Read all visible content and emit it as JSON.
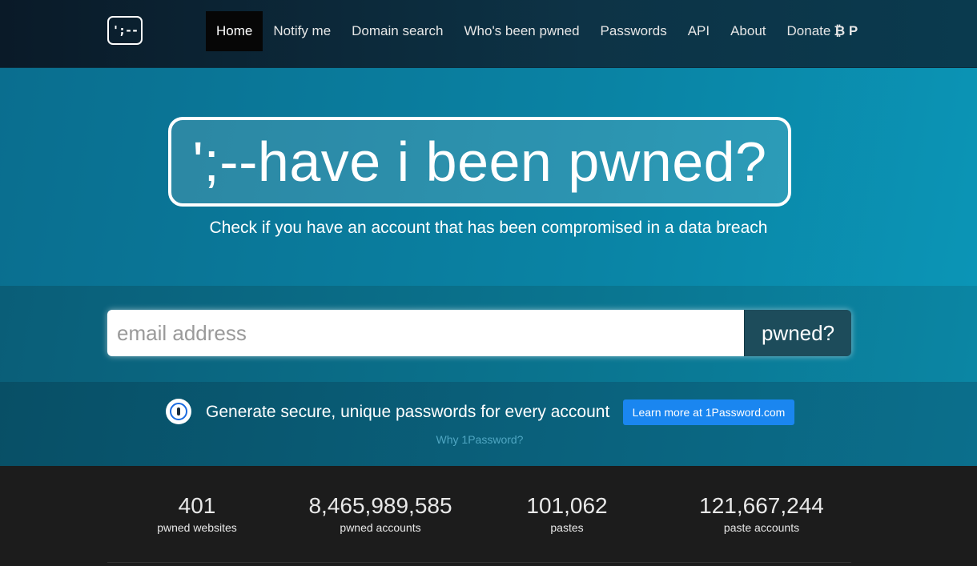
{
  "navbar": {
    "logo_text": "';--",
    "items": [
      {
        "label": "Home",
        "active": true
      },
      {
        "label": "Notify me"
      },
      {
        "label": "Domain search"
      },
      {
        "label": "Who's been pwned"
      },
      {
        "label": "Passwords"
      },
      {
        "label": "API"
      },
      {
        "label": "About"
      },
      {
        "label": "Donate",
        "icons": [
          "bitcoin-icon",
          "paypal-icon"
        ],
        "icon_text": "₿ P"
      }
    ]
  },
  "hero": {
    "title": "';--have i been pwned?",
    "subtitle": "Check if you have an account that has been compromised in a data breach"
  },
  "search": {
    "placeholder": "email address",
    "button_label": "pwned?"
  },
  "promo": {
    "text": "Generate secure, unique passwords for every account",
    "button_label": "Learn more at 1Password.com",
    "link_label": "Why 1Password?"
  },
  "stats": [
    {
      "value": "401",
      "label": "pwned websites"
    },
    {
      "value": "8,465,989,585",
      "label": "pwned accounts"
    },
    {
      "value": "101,062",
      "label": "pastes"
    },
    {
      "value": "121,667,244",
      "label": "paste accounts"
    }
  ],
  "colors": {
    "hero_bg": "#0a83a4",
    "search_button_bg": "#1d4c5b",
    "promo_button_bg": "#1a86f0",
    "stats_bg": "#1c1c1c"
  }
}
